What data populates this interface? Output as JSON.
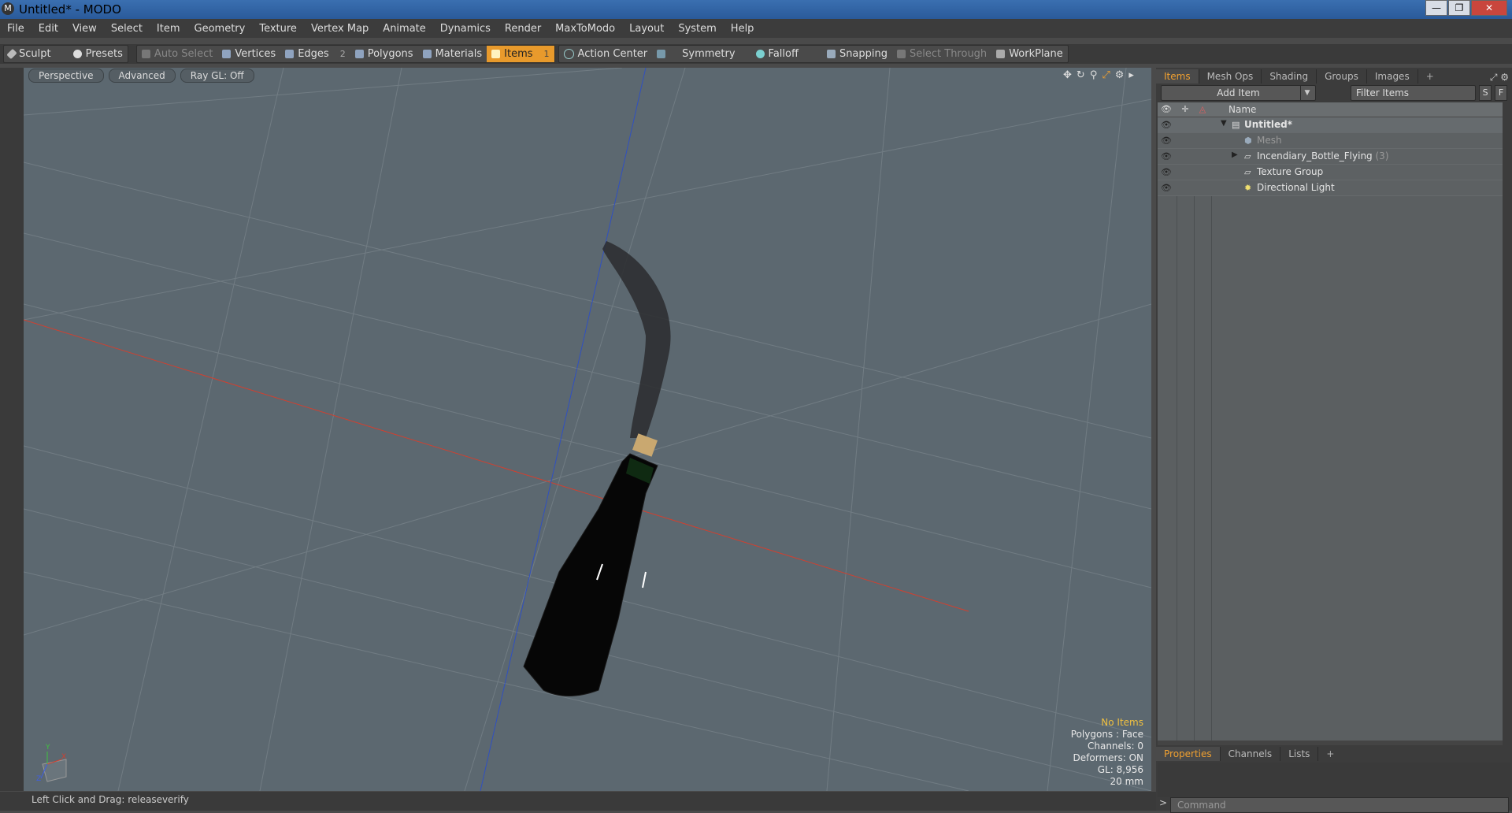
{
  "window": {
    "title": "Untitled* - MODO",
    "app_icon": "modo-logo-icon",
    "controls": [
      "—",
      "❐",
      "✕"
    ]
  },
  "menubar": [
    "File",
    "Edit",
    "View",
    "Select",
    "Item",
    "Geometry",
    "Texture",
    "Vertex Map",
    "Animate",
    "Dynamics",
    "Render",
    "MaxToModo",
    "Layout",
    "System",
    "Help"
  ],
  "toolbar": {
    "sculpt": "Sculpt",
    "presets": "Presets",
    "auto_select": "Auto Select",
    "vertices": "Vertices",
    "edges": "Edges",
    "edges_count": "2",
    "polygons": "Polygons",
    "materials": "Materials",
    "items": "Items",
    "items_count": "1",
    "action_center": "Action Center",
    "symmetry": "Symmetry",
    "falloff": "Falloff",
    "snapping": "Snapping",
    "select_through": "Select Through",
    "workplane": "WorkPlane"
  },
  "viewport": {
    "view_label": "Perspective",
    "style_label": "Advanced",
    "raygl_label": "Ray GL: Off",
    "stats": {
      "selection": "No Items",
      "polygons": "Polygons : Face",
      "channels": "Channels: 0",
      "deformers": "Deformers: ON",
      "gl": "GL: 8,956",
      "grid": "20 mm"
    },
    "axis_labels": {
      "y": "Y",
      "x": "X",
      "z": "Z"
    }
  },
  "status": {
    "hint": "Left Click and Drag:  releaseverify"
  },
  "item_panel": {
    "tabs": [
      "Items",
      "Mesh Ops",
      "Shading",
      "Groups",
      "Images",
      "+"
    ],
    "add_item": "Add Item",
    "filter_placeholder": "Filter Items",
    "s_btn": "S",
    "f_btn": "F",
    "column_name": "Name",
    "rows": [
      {
        "label": "Untitled*"
      },
      {
        "label": "Mesh"
      },
      {
        "label": "Incendiary_Bottle_Flying",
        "count": "(3)"
      },
      {
        "label": "Texture Group"
      },
      {
        "label": "Directional Light"
      }
    ]
  },
  "props_panel": {
    "tabs": [
      "Properties",
      "Channels",
      "Lists",
      "+"
    ],
    "command_placeholder": "Command",
    "prompt": ">"
  },
  "colors": {
    "accent": "#e89a2c",
    "viewport_bg": "#5c6870",
    "x_axis": "#d04030",
    "y_axis": "#3050c0"
  }
}
